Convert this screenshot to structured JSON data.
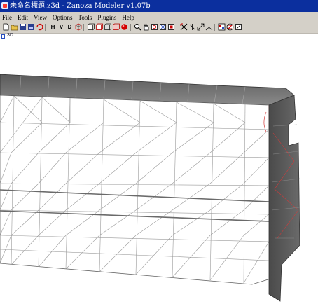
{
  "window": {
    "title": "未命名標題.z3d - Zanoza Modeler v1.07b"
  },
  "menu": [
    "File",
    "Edit",
    "View",
    "Options",
    "Tools",
    "Plugins",
    "Help"
  ],
  "toolbar": {
    "h_label": "H",
    "v_label": "V",
    "d_label": "D"
  },
  "view": {
    "tab_label": "3D"
  },
  "colors": {
    "titlebar": "#0b2f9e",
    "chrome": "#d4d0c8"
  }
}
